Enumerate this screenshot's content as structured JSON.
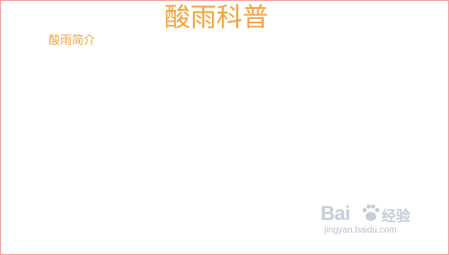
{
  "slide": {
    "title": "酸雨科普",
    "subtitle": "酸雨简介"
  },
  "watermark": {
    "logo_text": "Bai",
    "logo_cn": "经验",
    "url": "jingyan.baidu.com",
    "icon": "paw-icon",
    "color": "#c6cdd9"
  },
  "colors": {
    "text_accent": "#f3a33a",
    "border": "#f2a0a0",
    "background": "#ffffff"
  }
}
